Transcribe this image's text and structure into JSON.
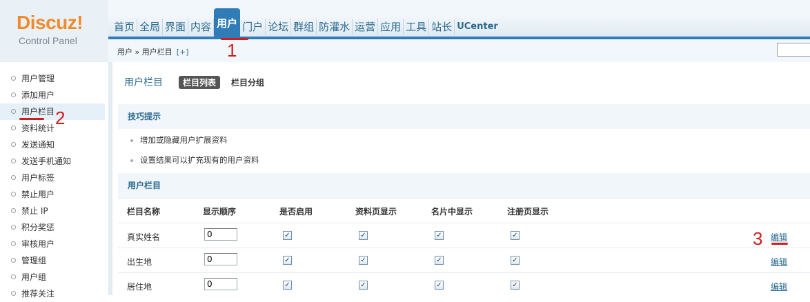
{
  "logo": {
    "title": "Discuz!",
    "subtitle": "Control Panel"
  },
  "nav": [
    "首页",
    "全局",
    "界面",
    "内容",
    "用户",
    "门户",
    "论坛",
    "群组",
    "防灌水",
    "运营",
    "应用",
    "工具",
    "站长",
    "UCenter"
  ],
  "nav_active_index": 4,
  "breadcrumb": {
    "text": "用户 » 用户栏目",
    "add": "[+]"
  },
  "annotations": [
    "1",
    "2",
    "3"
  ],
  "sidebar": [
    "用户管理",
    "添加用户",
    "用户栏目",
    "资料统计",
    "发送通知",
    "发送手机通知",
    "用户标签",
    "禁止用户",
    "禁止 IP",
    "积分奖惩",
    "审核用户",
    "管理组",
    "用户组",
    "推荐关注"
  ],
  "sidebar_active_index": 2,
  "main": {
    "title": "用户栏目",
    "tab_active": "栏目列表",
    "tab": "栏目分组",
    "tips_title": "技巧提示",
    "tips": [
      "增加或隐藏用户扩展资料",
      "设置结果可以扩充现有的用户资料"
    ],
    "section_title": "用户栏目",
    "columns": [
      "栏目名称",
      "显示顺序",
      "是否启用",
      "资料页显示",
      "名片中显示",
      "注册页显示"
    ],
    "rows": [
      {
        "name": "真实姓名",
        "order": "0",
        "enabled": true,
        "profile": true,
        "card": true,
        "register": true,
        "action": "编辑"
      },
      {
        "name": "出生地",
        "order": "0",
        "enabled": true,
        "profile": true,
        "card": true,
        "register": true,
        "action": "编辑"
      },
      {
        "name": "居住地",
        "order": "0",
        "enabled": true,
        "profile": true,
        "card": true,
        "register": true,
        "action": "编辑"
      }
    ]
  },
  "colors": {
    "accent": "#2f7cb6",
    "logo": "#ef8b2c",
    "annotation": "#d01c1c"
  }
}
